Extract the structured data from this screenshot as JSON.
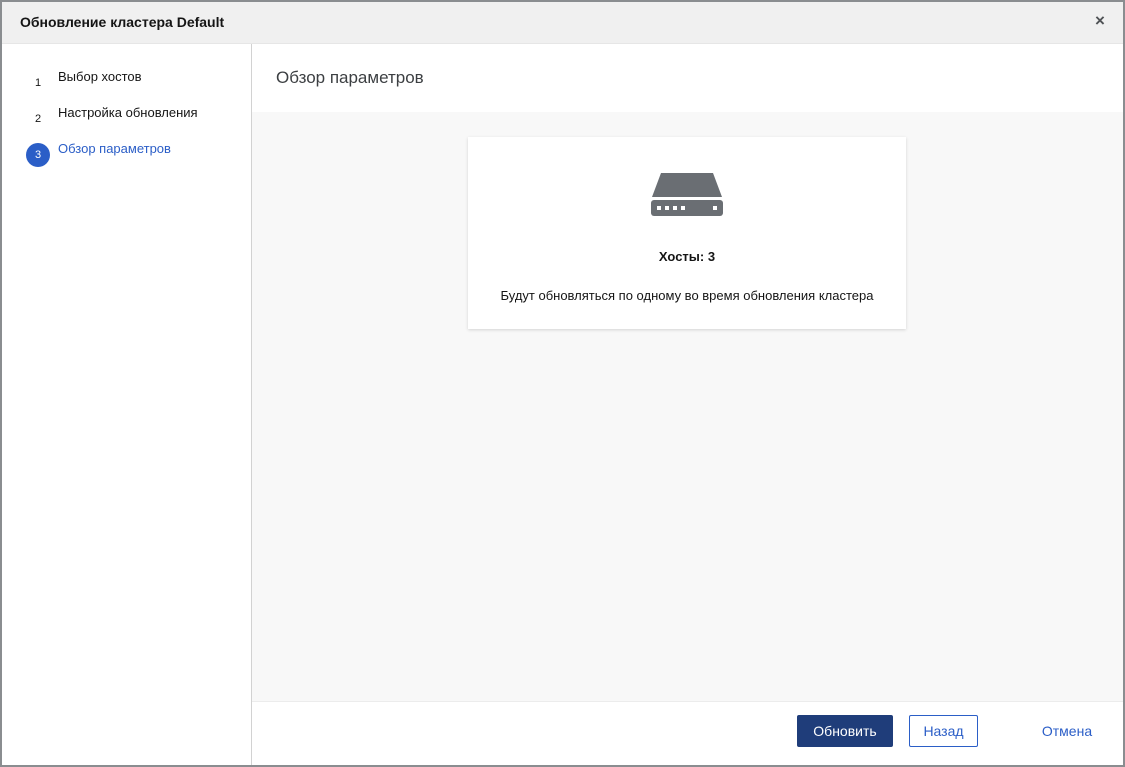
{
  "modal": {
    "title": "Обновление кластера Default",
    "close_symbol": "×"
  },
  "steps": [
    {
      "number": "1",
      "label": "Выбор хостов",
      "active": false
    },
    {
      "number": "2",
      "label": "Настройка обновления",
      "active": false
    },
    {
      "number": "3",
      "label": "Обзор параметров",
      "active": true
    }
  ],
  "main": {
    "title": "Обзор параметров",
    "card": {
      "icon": "server-icon",
      "count": "Хосты: 3",
      "description": "Будут обновляться по одному во время обновления кластера"
    }
  },
  "footer": {
    "primary_label": "Обновить",
    "back_label": "Назад",
    "cancel_label": "Отмена"
  },
  "colors": {
    "accent": "#2b5ec7",
    "primary_button": "#1f3d7a",
    "icon_gray": "#6a6e73"
  }
}
